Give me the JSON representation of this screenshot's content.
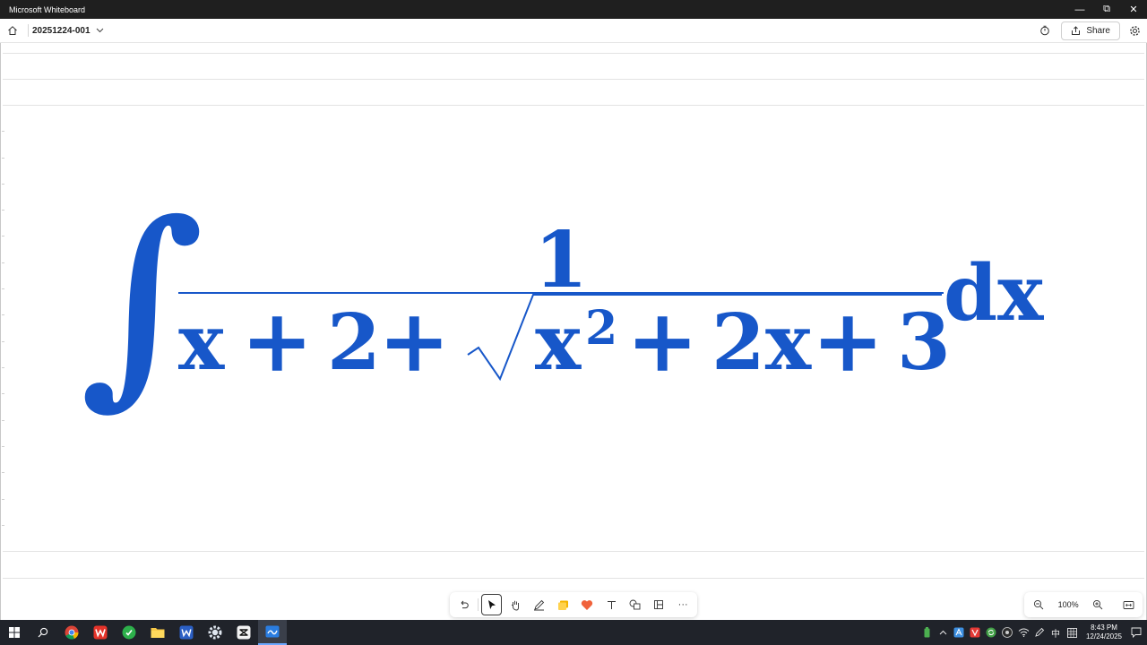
{
  "window": {
    "title": "Microsoft Whiteboard",
    "controls": {
      "minimize": "—",
      "restore": "⧉",
      "close": "✕"
    }
  },
  "header": {
    "board_name": "20251224-001",
    "share_label": "Share"
  },
  "canvas": {
    "ink_color": "#1757c9",
    "equation": {
      "integral": "∫",
      "numerator": "1",
      "denominator_terms": [
        "x",
        "+",
        "2",
        "+"
      ],
      "radicand_base": "x",
      "radicand_exponent": "2",
      "radicand_rest": [
        "+",
        "2x",
        "+",
        "3"
      ],
      "differential": "dx"
    }
  },
  "toolbar": {
    "tools": [
      "undo-icon",
      "select-icon",
      "pan-icon",
      "pen-icon",
      "sticky-note-icon",
      "reactions-icon",
      "text-icon",
      "shapes-icon",
      "templates-icon",
      "more-icon"
    ],
    "more_label": "···"
  },
  "zoom": {
    "level": "100%"
  },
  "taskbar": {
    "apps": [
      "windows-start-icon",
      "search-icon",
      "chrome-icon",
      "wps-icon",
      "green-app-icon",
      "file-explorer-icon",
      "word-icon",
      "settings-app-icon",
      "capcut-icon",
      "whiteboard-icon"
    ],
    "ime": "中",
    "time": "8:43 PM",
    "date": "12/24/2025"
  }
}
